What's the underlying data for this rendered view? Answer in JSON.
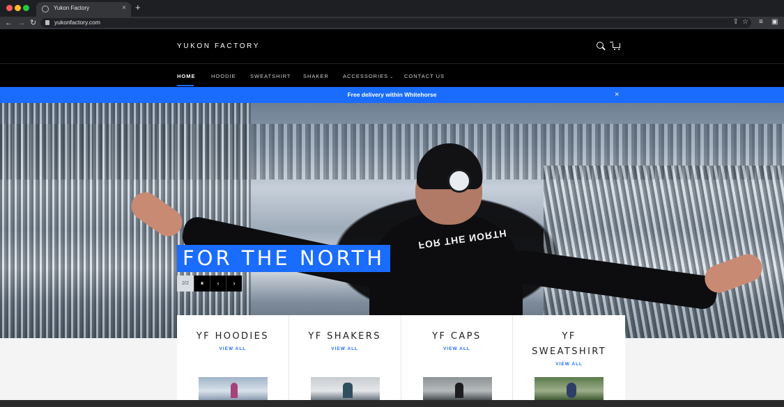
{
  "browser": {
    "tab_title": "Yukon Factory",
    "tab_close": "×",
    "new_tab": "+",
    "url": "yukonfactory.com",
    "back": "←",
    "forward": "→",
    "reload": "↻",
    "share": "⇪",
    "star": "☆",
    "extensions": "≡",
    "side_panel": "▣"
  },
  "header": {
    "logo": "YUKON FACTORY"
  },
  "menu": {
    "items": [
      {
        "label": "HOME"
      },
      {
        "label": "HOODIE"
      },
      {
        "label": "SWEATSHIRT"
      },
      {
        "label": "SHAKER"
      },
      {
        "label": "ACCESSORIES"
      },
      {
        "label": "CONTACT US"
      }
    ],
    "caret": "⌄"
  },
  "announcement": {
    "text": "Free delivery within Whitehorse",
    "close": "×"
  },
  "hero": {
    "title": "FOR THE NORTH",
    "hood_text": "FOR THE NORTH",
    "slide_count": "2/2",
    "pause": "⏸",
    "prev": "‹",
    "next": "›"
  },
  "collections": [
    {
      "title": "YF HOODIES",
      "link": "VIEW ALL"
    },
    {
      "title": "YF SHAKERS",
      "link": "VIEW ALL"
    },
    {
      "title": "YF CAPS",
      "link": "VIEW ALL"
    },
    {
      "title": "YF SWEATSHIRT",
      "link": "VIEW ALL"
    }
  ],
  "colors": {
    "accent": "#1a6cff",
    "header_bg": "#000000",
    "below_bg": "#f4f4f4"
  }
}
